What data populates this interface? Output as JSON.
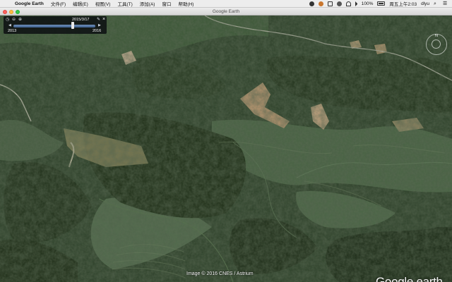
{
  "menubar": {
    "app_name": "Google Earth",
    "items": [
      "文件(F)",
      "编辑(E)",
      "视图(V)",
      "工具(T)",
      "添加(A)",
      "窗口",
      "帮助(H)"
    ],
    "battery": "100%",
    "clock": "周五上午2:03",
    "user": "dlyu"
  },
  "window": {
    "title": "Google Earth"
  },
  "time_slider": {
    "date": "2015/3/17",
    "start_year": "2013",
    "end_year": "2016",
    "position_fraction": 0.72
  },
  "compass": {
    "north": "N"
  },
  "attribution": "Image © 2016 CNES / Astrium",
  "logo": "Google earth",
  "colors": {
    "close": "#fc605c",
    "minimize": "#fdbc40",
    "maximize": "#34c84a",
    "slider_track": "#3d5f8e",
    "forest": "#2c3d27",
    "field": "#4c6147",
    "bare_soil": "#b39a79"
  }
}
